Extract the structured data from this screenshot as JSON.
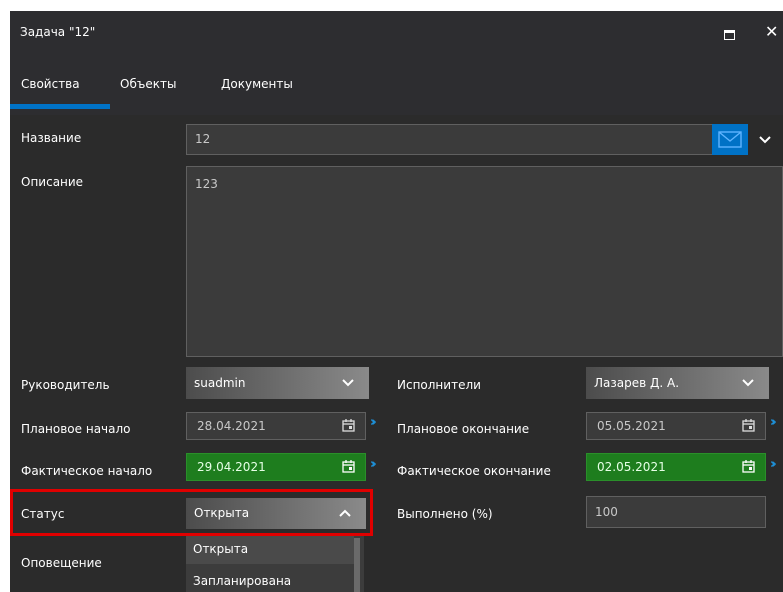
{
  "window": {
    "title": "Задача \"12\""
  },
  "tabs": [
    {
      "label": "Свойства"
    },
    {
      "label": "Объекты"
    },
    {
      "label": "Документы"
    }
  ],
  "form": {
    "name_label": "Название",
    "name_value": "12",
    "description_label": "Описание",
    "description_value": "123",
    "manager_label": "Руководитель",
    "manager_value": "suadmin",
    "executors_label": "Исполнители",
    "executors_value": "Лазарев Д. А.",
    "planned_start_label": "Плановое начало",
    "planned_start_value": "28.04.2021",
    "planned_end_label": "Плановое окончание",
    "planned_end_value": "05.05.2021",
    "actual_start_label": "Фактическое начало",
    "actual_start_value": "29.04.2021",
    "actual_end_label": "Фактическое окончание",
    "actual_end_value": "02.05.2021",
    "status_label": "Статус",
    "status_value": "Открыта",
    "percent_label": "Выполнено (%)",
    "percent_value": "100",
    "notify_label": "Оповещение",
    "status_options": [
      "Открыта",
      "Запланирована"
    ]
  },
  "colors": {
    "accent": "#0072c6",
    "date_highlight": "#1e7d1e",
    "highlight_box": "#e00000"
  }
}
